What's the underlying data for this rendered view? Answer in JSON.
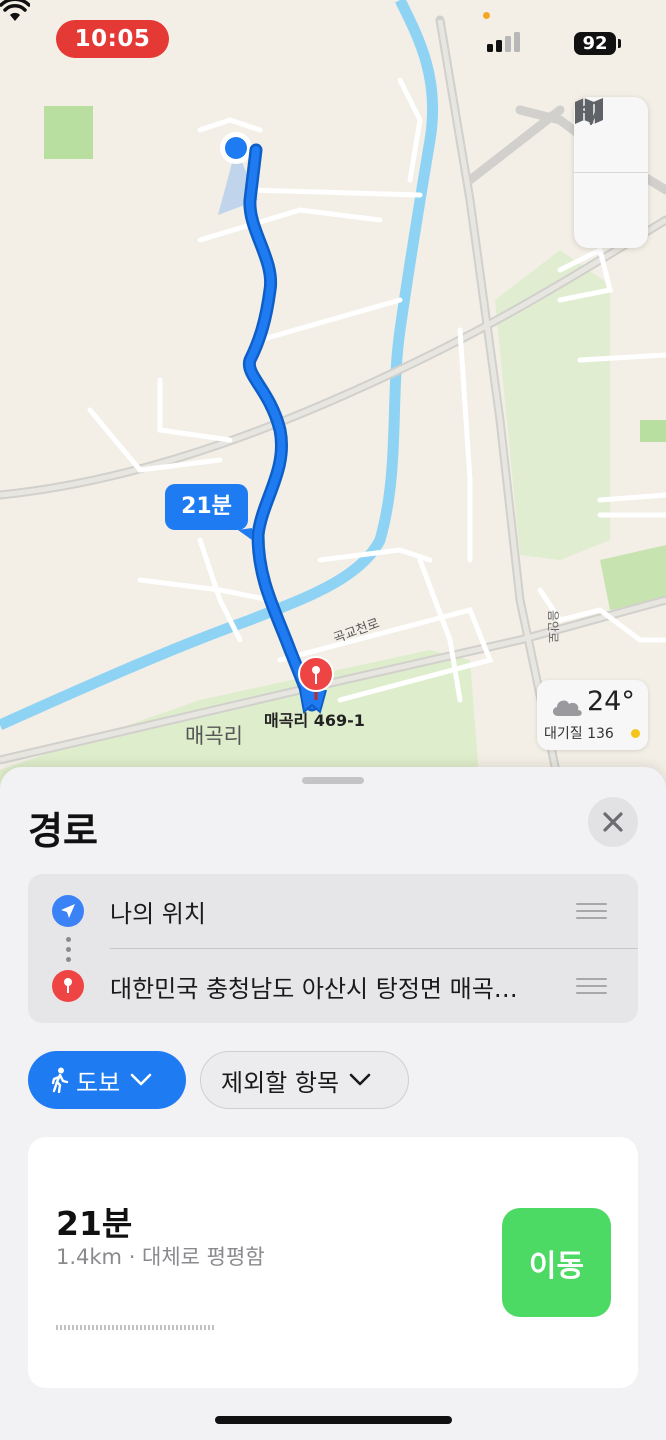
{
  "status_bar": {
    "time": "10:05",
    "battery": "92"
  },
  "map": {
    "route_time_label": "21분",
    "destination_label": "매곡리 469-1",
    "area_label": "매곡리",
    "road_label": "곡교천로",
    "road_label_2": "음안로",
    "weather": {
      "temp": "24°",
      "aqi": "대기질 136",
      "icon": "cloud-icon",
      "aqi_color": "#f4c518"
    },
    "colors": {
      "route": "#1e7bf2",
      "river": "#8fd3f4",
      "park": "#b9dfa0"
    }
  },
  "sheet": {
    "title": "경로",
    "waypoints": [
      {
        "label": "나의 위치",
        "icon": "location-arrow-icon",
        "color": "#3b82f6"
      },
      {
        "label": "대한민국 충청남도 아산시 탕정면 매곡…",
        "icon": "pin-icon",
        "color": "#ef4444"
      }
    ],
    "mode_chip": "도보",
    "avoid_chip": "제외할 항목",
    "route": {
      "time": "21분",
      "detail": "1.4km · 대체로 평평함",
      "go_label": "이동"
    }
  }
}
